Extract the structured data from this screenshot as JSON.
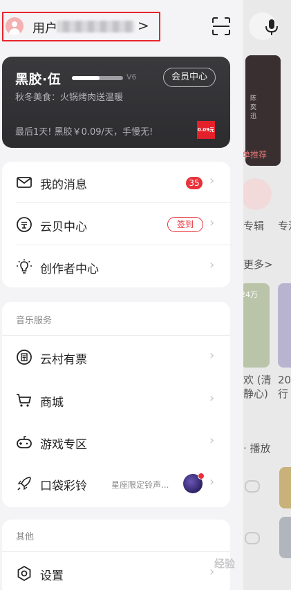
{
  "header": {
    "username_prefix": "用户",
    "user_arrow": ">"
  },
  "vip": {
    "title": "黑胶·伍",
    "level": "V6",
    "center_button": "会员中心",
    "subtitle": "秋冬美食：火锅烤肉送温暖",
    "offer": "最后1天! 黑胶￥0.09/天，手慢无!",
    "badge": "0.09元"
  },
  "menu_main": [
    {
      "label": "我的消息",
      "badge": "35",
      "icon": "mail-icon"
    },
    {
      "label": "云贝中心",
      "action": "签到",
      "icon": "coin-icon"
    },
    {
      "label": "创作者中心",
      "icon": "bulb-icon"
    }
  ],
  "music_services": {
    "title": "音乐服务",
    "items": [
      {
        "label": "云村有票",
        "icon": "ticket-icon"
      },
      {
        "label": "商城",
        "icon": "cart-icon"
      },
      {
        "label": "游戏专区",
        "icon": "gamepad-icon"
      },
      {
        "label": "口袋彩铃",
        "sub": "星座限定铃声...",
        "icon": "rocket-icon"
      }
    ]
  },
  "other": {
    "title": "其他",
    "items": [
      {
        "label": "设置",
        "icon": "settings-icon"
      }
    ]
  },
  "background": {
    "artist_text": "陈\n奕\n迅",
    "recommend": "单推荐",
    "album": "专辑",
    "album2": "专流",
    "more": "更多>",
    "count": "24万",
    "song_snippet": "欢 (清\n静心)",
    "song_snippet2": "20\n行",
    "play_label": "· 播放"
  },
  "watermark": "经验",
  "colors": {
    "accent": "#e8323a",
    "vip_bg": "#2f2f32"
  }
}
